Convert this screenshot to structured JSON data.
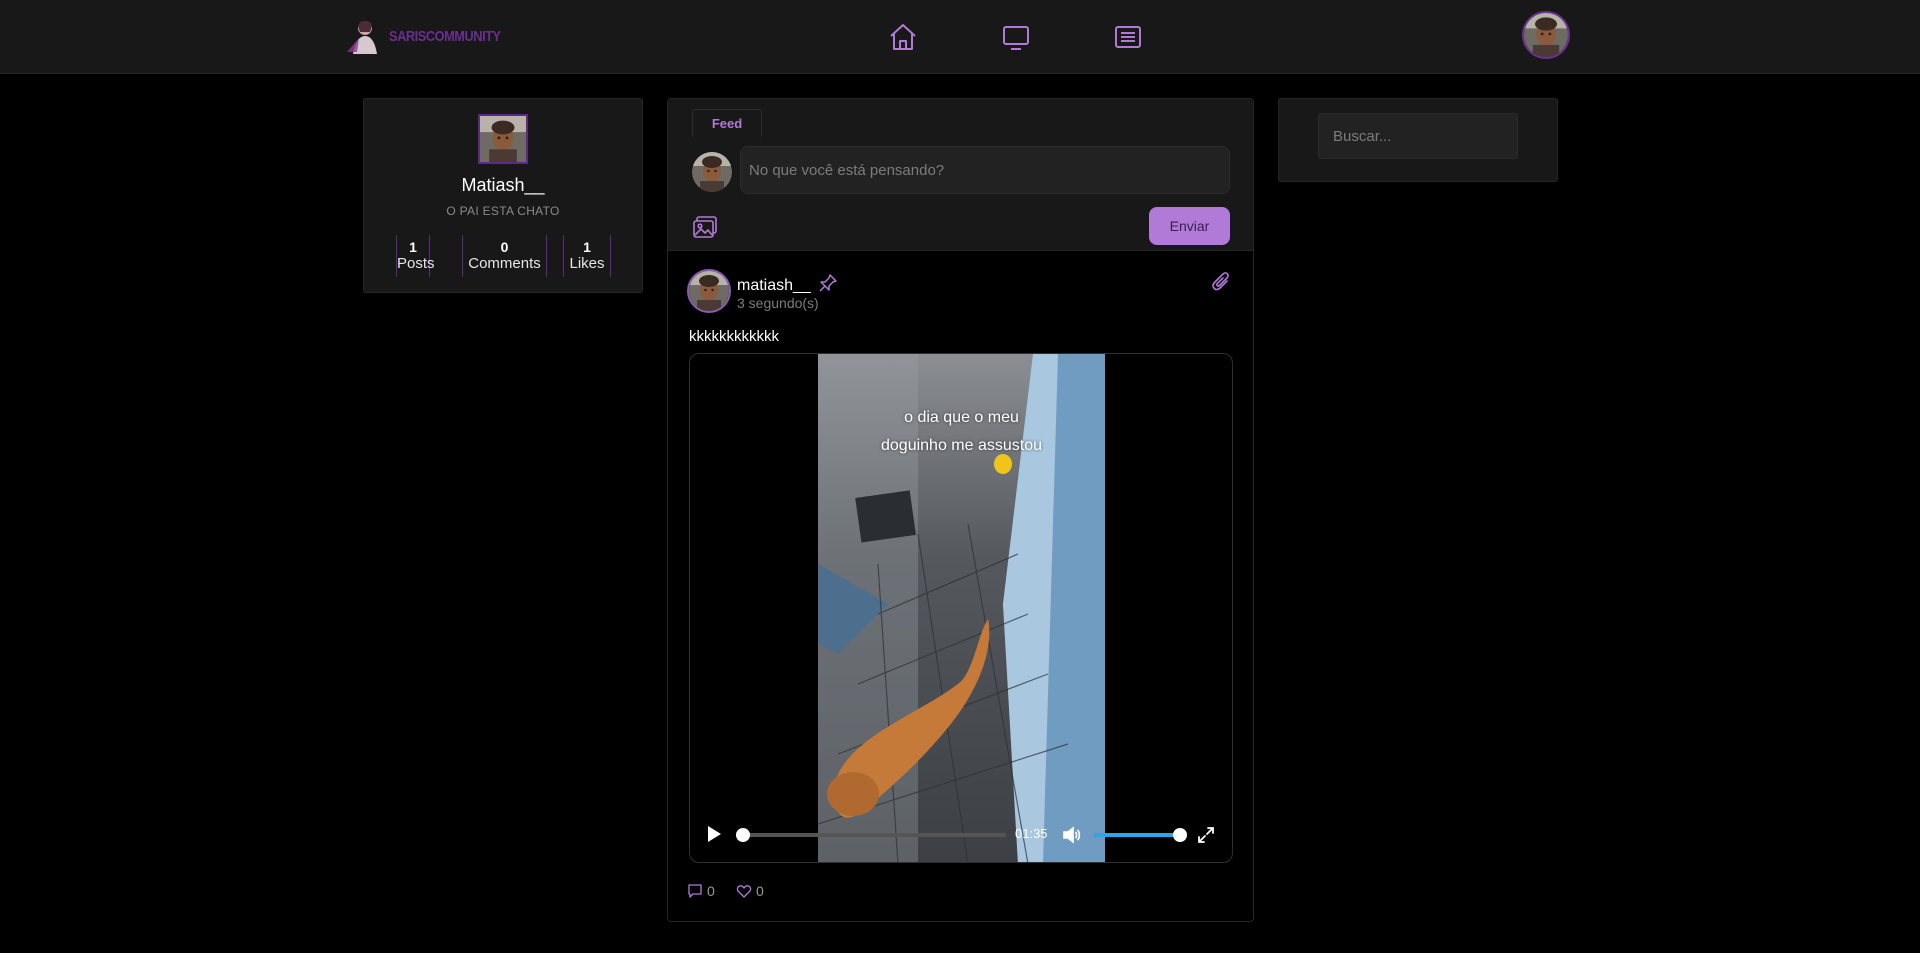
{
  "header": {
    "logo_text": "SARISCOMMUNITY",
    "nav": [
      "home-icon",
      "tv-icon",
      "list-icon"
    ],
    "accent_color": "#b07ad6"
  },
  "profile": {
    "name": "Matiash__",
    "bio": "O PAI ESTA CHATO",
    "stats": [
      {
        "value": "1",
        "label": "Posts"
      },
      {
        "value": "0",
        "label": "Comments"
      },
      {
        "value": "1",
        "label": "Likes"
      }
    ]
  },
  "composer": {
    "tab_label": "Feed",
    "placeholder": "No que você está pensando?",
    "send_label": "Enviar"
  },
  "post": {
    "username": "matiash__",
    "time": "3 segundo(s)",
    "text": "kkkkkkkkkkkk",
    "video": {
      "caption_line1": "o dia que o meu",
      "caption_line2": "doguinho me assustou",
      "duration": "01:35",
      "progress": 0,
      "volume": 1
    },
    "comments_count": "0",
    "likes_count": "0"
  },
  "search": {
    "placeholder": "Buscar..."
  }
}
